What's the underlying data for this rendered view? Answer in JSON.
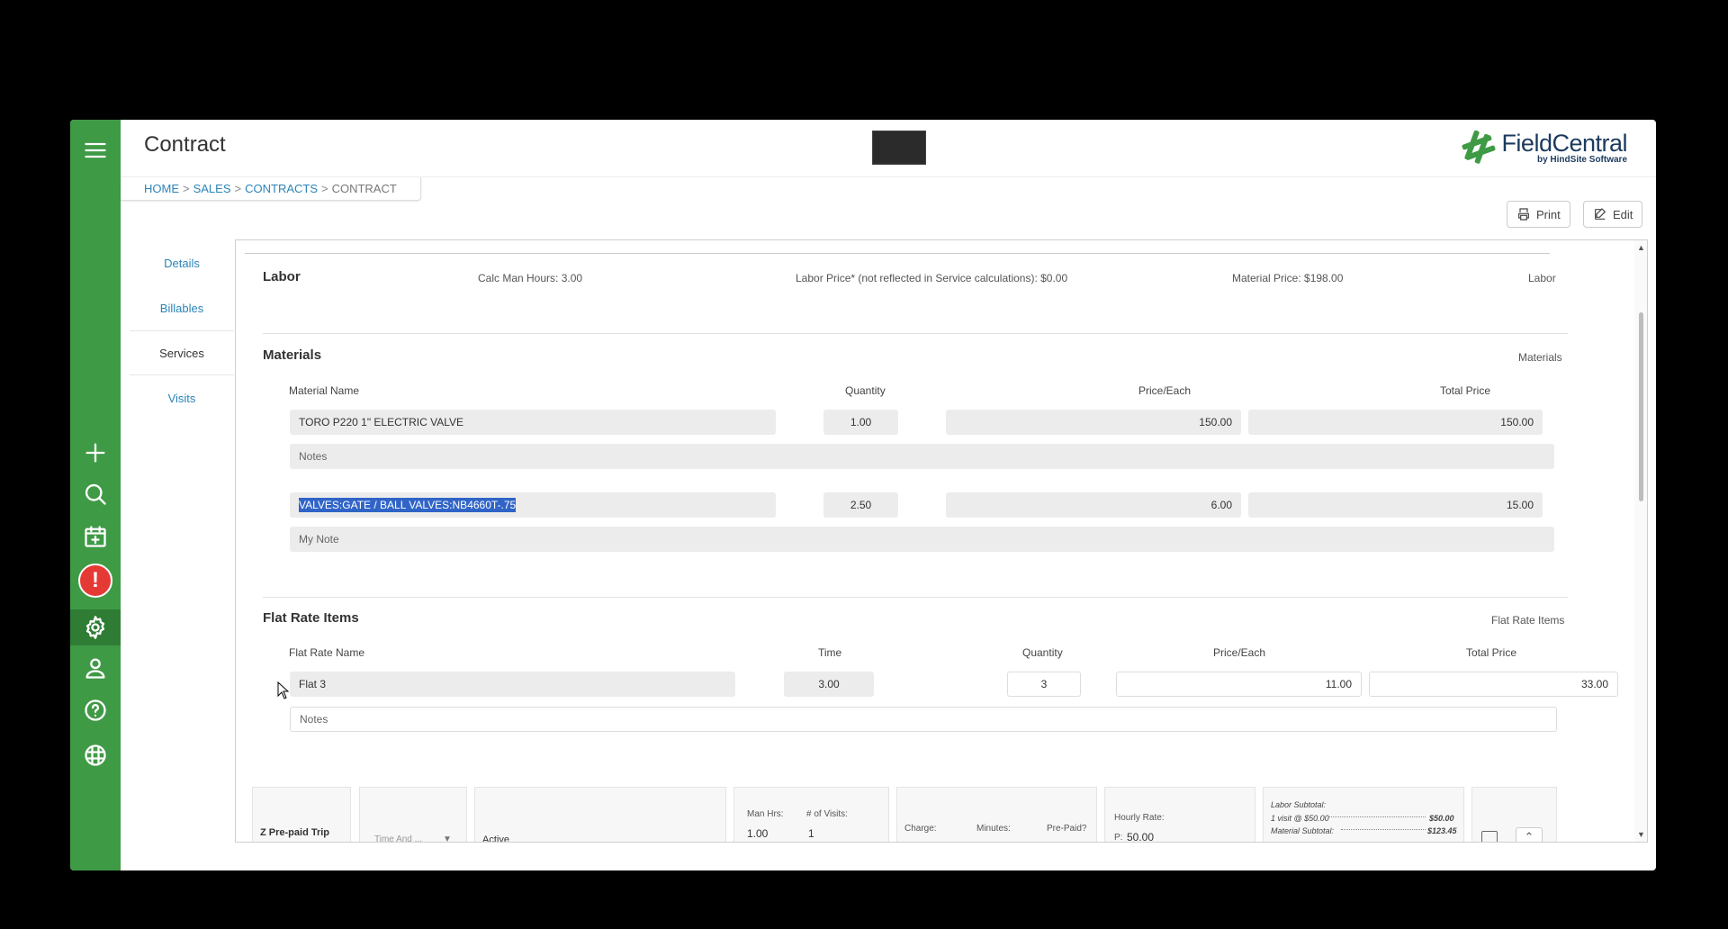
{
  "header": {
    "title": "Contract",
    "logo_brand": "FieldCentral",
    "logo_sub": "by HindSite Software"
  },
  "breadcrumb": {
    "items": [
      "HOME",
      "SALES",
      "CONTRACTS"
    ],
    "current": "CONTRACT",
    "sep": ">"
  },
  "toolbar": {
    "print_label": "Print",
    "edit_label": "Edit"
  },
  "sidenav": {
    "items": [
      {
        "label": "Details"
      },
      {
        "label": "Billables"
      },
      {
        "label": "Services"
      },
      {
        "label": "Visits"
      }
    ]
  },
  "labor": {
    "title": "Labor",
    "calc_man_hours": "Calc Man Hours: 3.00",
    "labor_price": "Labor Price* (not reflected in Service calculations): $0.00",
    "material_price": "Material Price: $198.00",
    "tag": "Labor"
  },
  "materials": {
    "title": "Materials",
    "tag": "Materials",
    "columns": [
      "Material Name",
      "Quantity",
      "Price/Each",
      "Total Price"
    ],
    "rows": [
      {
        "name": "TORO P220 1\" ELECTRIC VALVE",
        "quantity": "1.00",
        "price_each": "150.00",
        "total": "150.00",
        "notes": "Notes"
      },
      {
        "name": "VALVES:GATE / BALL VALVES:NB4660T-.75",
        "quantity": "2.50",
        "price_each": "6.00",
        "total": "15.00",
        "notes": "My Note"
      }
    ]
  },
  "flat_rate": {
    "title": "Flat Rate Items",
    "tag": "Flat Rate Items",
    "columns": [
      "Flat Rate Name",
      "Time",
      "Quantity",
      "Price/Each",
      "Total Price"
    ],
    "rows": [
      {
        "name": "Flat 3",
        "time": "3.00",
        "quantity": "3",
        "price_each": "11.00",
        "total": "33.00",
        "notes": "Notes"
      }
    ]
  },
  "bottom_row": {
    "service_name": "Z Pre-paid Trip",
    "type_select": "Time And ...",
    "status": "Active",
    "man_hrs_label": "Man Hrs:",
    "man_hrs": "1.00",
    "visits_label": "# of Visits:",
    "visits": "1",
    "charge_label": "Charge:",
    "minutes_label": "Minutes:",
    "prepaid_label": "Pre-Paid?",
    "hourly_rate_label": "Hourly Rate:",
    "hourly_rate_prefix": "P:",
    "hourly_rate": "50.00",
    "labor_subtotal_label": "Labor Subtotal:",
    "visit_line": "1 visit @ $50.00",
    "visit_amount": "$50.00",
    "material_subtotal_label": "Material Subtotal:",
    "material_amount": "$123.45"
  },
  "colors": {
    "rail": "#3f9a45",
    "link": "#2b84b8",
    "alert": "#e53935",
    "selection": "#3064c7"
  },
  "icons": [
    "menu-icon",
    "plus-icon",
    "search-icon",
    "calendar-add-icon",
    "alert-icon",
    "gear-icon",
    "user-icon",
    "help-icon",
    "logo-mark-icon",
    "print-icon",
    "edit-icon"
  ]
}
